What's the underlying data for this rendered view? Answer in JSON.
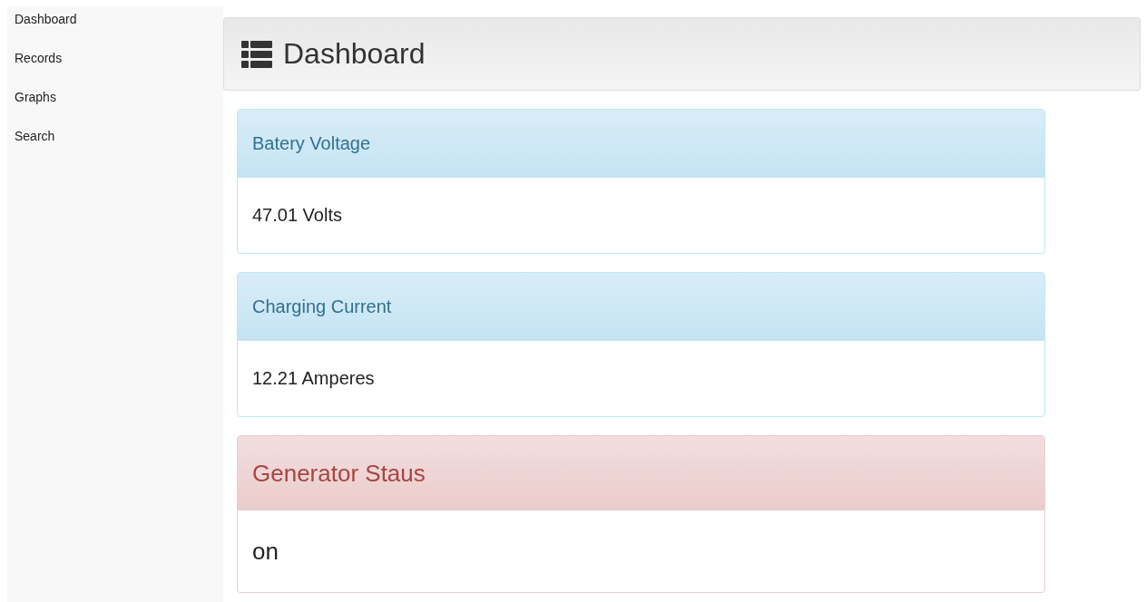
{
  "sidebar": {
    "items": [
      {
        "label": "Dashboard"
      },
      {
        "label": "Records"
      },
      {
        "label": "Graphs"
      },
      {
        "label": "Search"
      }
    ]
  },
  "header": {
    "title": "Dashboard"
  },
  "panels": [
    {
      "kind": "info",
      "title": "Batery Voltage",
      "value": "47.01 Volts"
    },
    {
      "kind": "info",
      "title": "Charging Current",
      "value": "12.21 Amperes"
    },
    {
      "kind": "danger",
      "title": "Generator Staus",
      "value": "on"
    }
  ]
}
